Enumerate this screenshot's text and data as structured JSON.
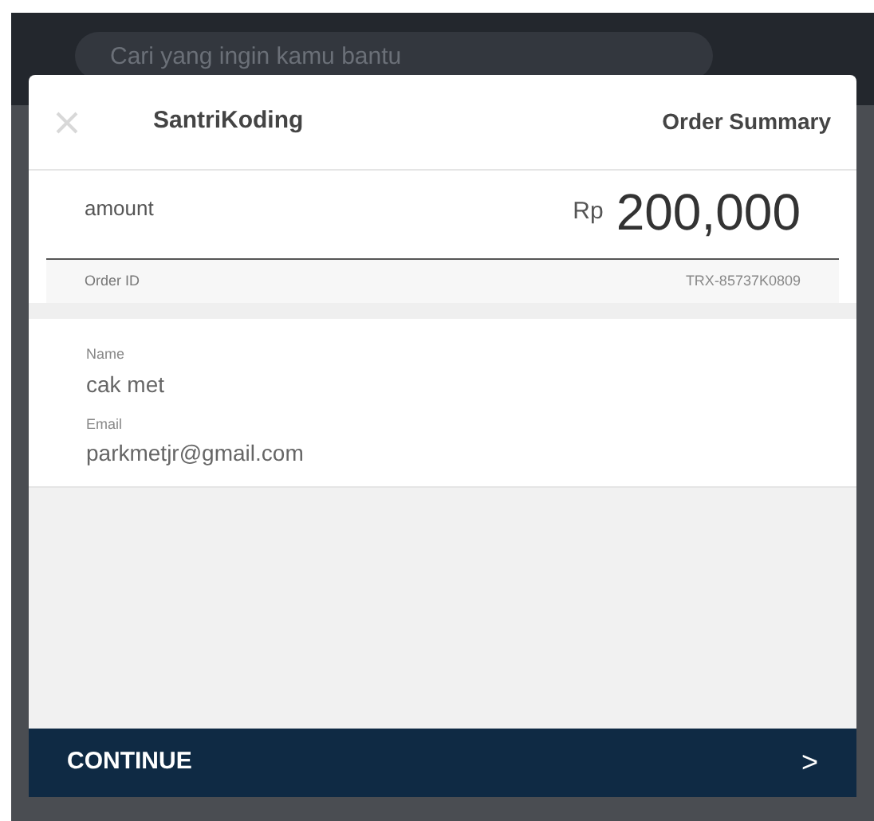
{
  "search": {
    "placeholder": "Cari yang ingin kamu bantu"
  },
  "modal": {
    "merchant": "SantriKoding",
    "title": "Order Summary",
    "amount_label": "amount",
    "currency": "Rp",
    "amount": "200,000",
    "order_id_label": "Order ID",
    "order_id": "TRX-85737K0809",
    "fields": [
      {
        "label": "Name",
        "value": "cak met"
      },
      {
        "label": "Email",
        "value": "parkmetjr@gmail.com"
      }
    ],
    "continue": "CONTINUE",
    "continue_arrow": ">"
  }
}
